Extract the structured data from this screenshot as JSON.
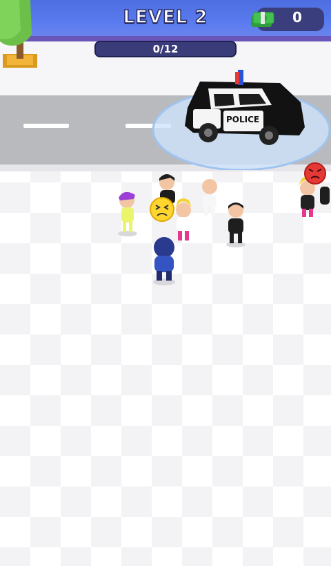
{
  "hud": {
    "level_label": "LEVEL 2",
    "cash_value": "0",
    "cash_icon": "cash-stack-icon",
    "progress_label": "0/12",
    "progress_fraction": 0
  },
  "scene": {
    "police_car_text": "POLICE",
    "emotes": [
      "sad-face-icon",
      "angry-face-icon"
    ]
  },
  "colors": {
    "sky": "#5b7cf0",
    "road": "#b9babd",
    "hud_panel": "#3b3e7c",
    "police_light": "#e53935"
  }
}
